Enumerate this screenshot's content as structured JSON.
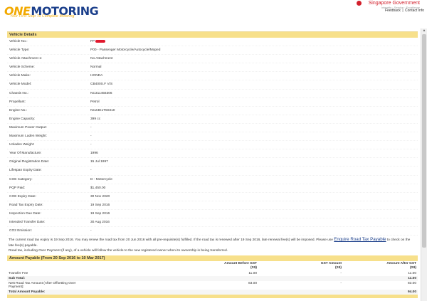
{
  "header": {
    "logo_one": "ONE",
    "logo_motoring": "MOTORING",
    "tagline": "Your First Stop To Complete Motoring",
    "gov_name": "Singapore Government",
    "gov_motto": "Integrity · Service · Excellence",
    "feedback": "Feedback",
    "sep": "|",
    "contact": "Contact Info"
  },
  "vehicle_details": {
    "title": "Vehicle Details",
    "rows": [
      {
        "label": "Vehicle No.:",
        "value": "FP"
      },
      {
        "label": "Vehicle Type:",
        "value": "P00 - Passenger Motorcycle/Autocycle/Moped"
      },
      {
        "label": "Vehicle Attachment 1:",
        "value": "No Attachment"
      },
      {
        "label": "Vehicle Scheme:",
        "value": "Normal"
      },
      {
        "label": "Vehicle Make:",
        "value": "HONDA"
      },
      {
        "label": "Vehicle Model:",
        "value": "CB400S.F V/S"
      },
      {
        "label": "Chassis No.:",
        "value": "NC311456306"
      },
      {
        "label": "Propellant:",
        "value": "Petrol"
      },
      {
        "label": "Engine No.:",
        "value": "NC23E1T50310"
      },
      {
        "label": "Engine Capacity:",
        "value": "399 cc"
      },
      {
        "label": "Maximum Power Output:",
        "value": "-"
      },
      {
        "label": "Maximum Laden Weight:",
        "value": "-"
      },
      {
        "label": "Unladen Weight:",
        "value": "-"
      },
      {
        "label": "Year Of Manufacture:",
        "value": "1996"
      },
      {
        "label": "Original Registration Date:",
        "value": "15 Jul 1997"
      },
      {
        "label": "Lifespan Expiry Date:",
        "value": "-"
      },
      {
        "label": "COE Category:",
        "value": "D - Motorcycle"
      },
      {
        "label": "PQP Paid:",
        "value": "$1,450.00"
      },
      {
        "label": "COE Expiry Date:",
        "value": "30 Nov 2020"
      },
      {
        "label": "Road Tax Expiry Date:",
        "value": "19 Sep 2016"
      },
      {
        "label": "Inspection Due Date:",
        "value": "19 Sep 2016"
      },
      {
        "label": "Intended Transfer Date:",
        "value": "30 Aug 2016"
      },
      {
        "label": "CO2 Emission:",
        "value": "-"
      }
    ]
  },
  "notice": {
    "text": "The current road tax expiry is 19 Sep 2016. You may renew the road tax from 20 Jun 2016 with all pre-requisite(s) fulfilled. If the road tax is renewed after 19 Sep 2016, late renewal fee(s) will be imposed. Please use ",
    "link": "Enquire Road Tax Payable",
    "suffix": " to check on the late fee(s) payable.",
    "text2": "Road tax, including Over Payment (if any), of a vehicle will follow the vehicle to the new registered owner when its ownership is being transferred."
  },
  "amount": {
    "title": "Amount Payable (From 20 Sep 2016 to 10 Mar 2017)",
    "col_before": "Amount Before GST",
    "col_gst": "GST Amount",
    "col_after": "Amount After GST",
    "currency": "(S$)",
    "rows": [
      {
        "label": "Transfer Fee",
        "before": "11.00",
        "gst": "-",
        "after": "11.00"
      }
    ],
    "subtotal_label": "Sub Total:",
    "subtotal_value": "11.00",
    "net_label": "Nett Road Tax Amount (After Offsetting Over Payment):",
    "net_before": "83.00",
    "net_gst": "-",
    "net_after": "83.00",
    "total_label": "Total Amount Payable:",
    "total_value": "94.00"
  }
}
